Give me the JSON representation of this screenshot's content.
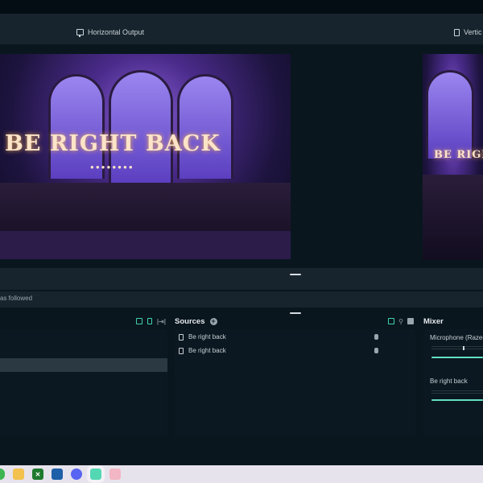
{
  "outputs": {
    "horizontal": "Horizontal Output",
    "vertical": "Vertic"
  },
  "preview": {
    "title": "BE RIGHT BACK",
    "vertical_title": "BE RIGHT BACK"
  },
  "status": {
    "text": "as followed"
  },
  "scenes": {
    "items": [
      "",
      ""
    ],
    "selected": 1
  },
  "sources": {
    "title": "Sources",
    "items": [
      "Be right back",
      "Be right back"
    ]
  },
  "mixer": {
    "title": "Mixer",
    "channels": [
      {
        "name": "Microphone (Razer",
        "volume": 1.0
      },
      {
        "name": "Be right back",
        "volume": 1.0
      }
    ]
  },
  "colors": {
    "accent": "#3fd3a8",
    "panel": "#17242d",
    "background": "#09161e"
  },
  "taskbar": {
    "apps": [
      "chrome-icon",
      "file-explorer-icon",
      "xbox-icon",
      "microsoft-store-icon",
      "discord-icon",
      "streamlabs-icon",
      "app-icon"
    ]
  }
}
